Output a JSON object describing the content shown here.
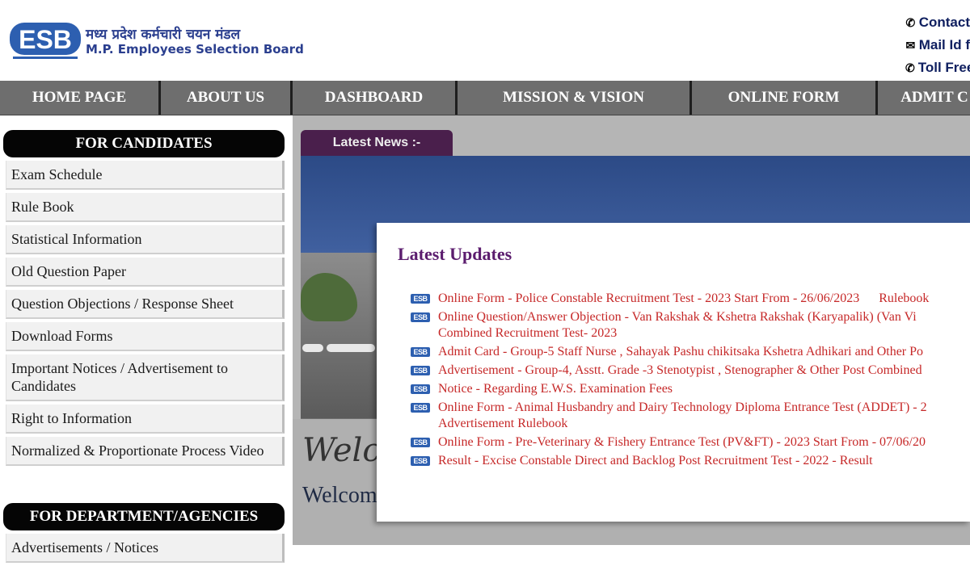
{
  "header": {
    "title_hi": "मध्य प्रदेश कर्मचारी चयन मंडल",
    "title_en": "M.P. Employees Selection Board",
    "logo_text": "ESB",
    "contacts": [
      {
        "icon": "phone-icon",
        "label": "Contact"
      },
      {
        "icon": "mail-icon",
        "label": "Mail Id f"
      },
      {
        "icon": "phone-icon",
        "label": "Toll Free"
      }
    ]
  },
  "nav": [
    {
      "label": "HOME PAGE"
    },
    {
      "label": "ABOUT US"
    },
    {
      "label": "DASHBOARD"
    },
    {
      "label": "MISSION & VISION"
    },
    {
      "label": "ONLINE FORM"
    },
    {
      "label": "ADMIT C"
    }
  ],
  "sidebar": {
    "candidates_title": "FOR CANDIDATES",
    "candidates_items": [
      "Exam Schedule",
      "Rule Book",
      "Statistical Information",
      "Old Question Paper",
      "Question Objections / Response Sheet",
      "Download Forms",
      "Important Notices / Advertisement to Candidates",
      "Right to Information",
      "Normalized & Proportionate Process Video"
    ],
    "department_title": "FOR DEPARTMENT/AGENCIES",
    "department_items": [
      "Advertisements / Notices"
    ]
  },
  "main": {
    "news_tab": "Latest News :-",
    "welcome_italic": "Welco",
    "welcome_plain": "Welcom",
    "updates_title": "Latest Updates",
    "updates": [
      {
        "text": "Online Form - Police Constable Recruitment Test - 2023 Start From - 26/06/2023",
        "extra": "Rulebook"
      },
      {
        "text": "Online Question/Answer Objection   - Van Rakshak & Kshetra Rakshak (Karyapalik) (Van Vi Combined Recruitment Test- 2023",
        "extra": ""
      },
      {
        "text": "Admit Card  - Group-5 Staff Nurse , Sahayak Pashu chikitsaka Kshetra Adhikari and Other Po",
        "extra": ""
      },
      {
        "text": "Advertisement - Group-4, Asstt. Grade -3 Stenotypist , Stenographer & Other Post Combined",
        "extra": ""
      },
      {
        "text": "Notice - Regarding E.W.S. Examination Fees",
        "extra": ""
      },
      {
        "text": "Online Form - Animal Husbandry and Dairy Technology Diploma Entrance Test (ADDET) - 2 Advertisement  Rulebook",
        "extra": ""
      },
      {
        "text": "Online Form - Pre-Veterinary & Fishery Entrance Test (PV&FT) - 2023 Start From - 07/06/20",
        "extra": ""
      },
      {
        "text": "Result - Excise Constable Direct and Backlog Post Recruitment Test - 2022 - Result",
        "extra": ""
      }
    ],
    "update_icon_text": "ESB"
  },
  "colors": {
    "nav_bg": "#6e6e6e",
    "accent_purple": "#5b1c6e",
    "update_red": "#c62828",
    "brand_blue": "#2b3f8f"
  }
}
